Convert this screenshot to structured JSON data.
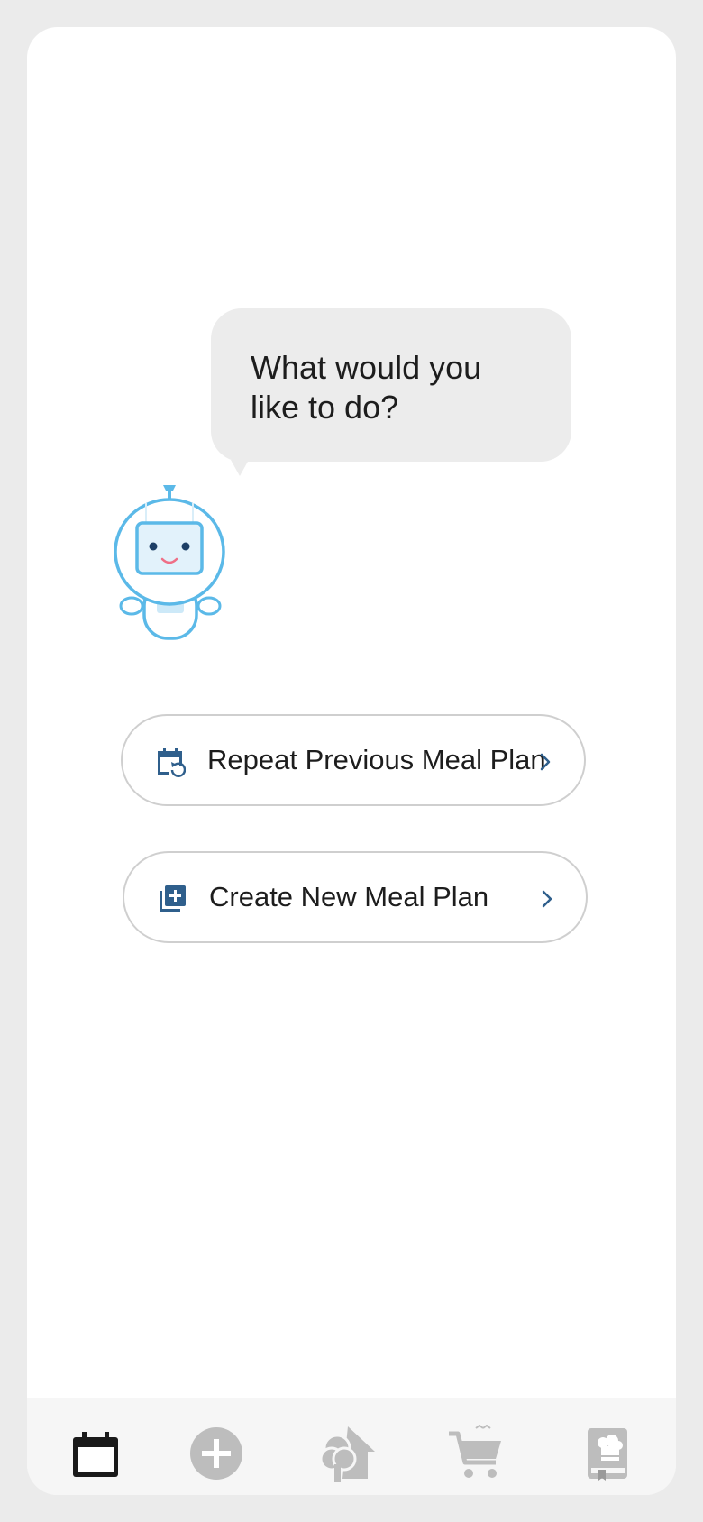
{
  "assistant": {
    "message": "What would you like to do?"
  },
  "actions": [
    {
      "label": "Repeat Previous Meal Plan",
      "icon": "calendar-repeat-icon"
    },
    {
      "label": "Create New Meal Plan",
      "icon": "add-plan-icon"
    }
  ],
  "tabbar": {
    "tabs": [
      {
        "icon": "calendar-icon",
        "active": true
      },
      {
        "icon": "plus-circle-icon",
        "active": false
      },
      {
        "icon": "tree-house-icon",
        "active": false
      },
      {
        "icon": "cart-icon",
        "active": false
      },
      {
        "icon": "recipe-book-icon",
        "active": false
      }
    ]
  },
  "colors": {
    "background": "#ebebeb",
    "bubble": "#ececec",
    "accent_blue": "#2f5f8c",
    "robot_blue": "#5bb9e8",
    "inactive_icon": "#bdbdbd",
    "active_icon": "#1a1a1a"
  }
}
